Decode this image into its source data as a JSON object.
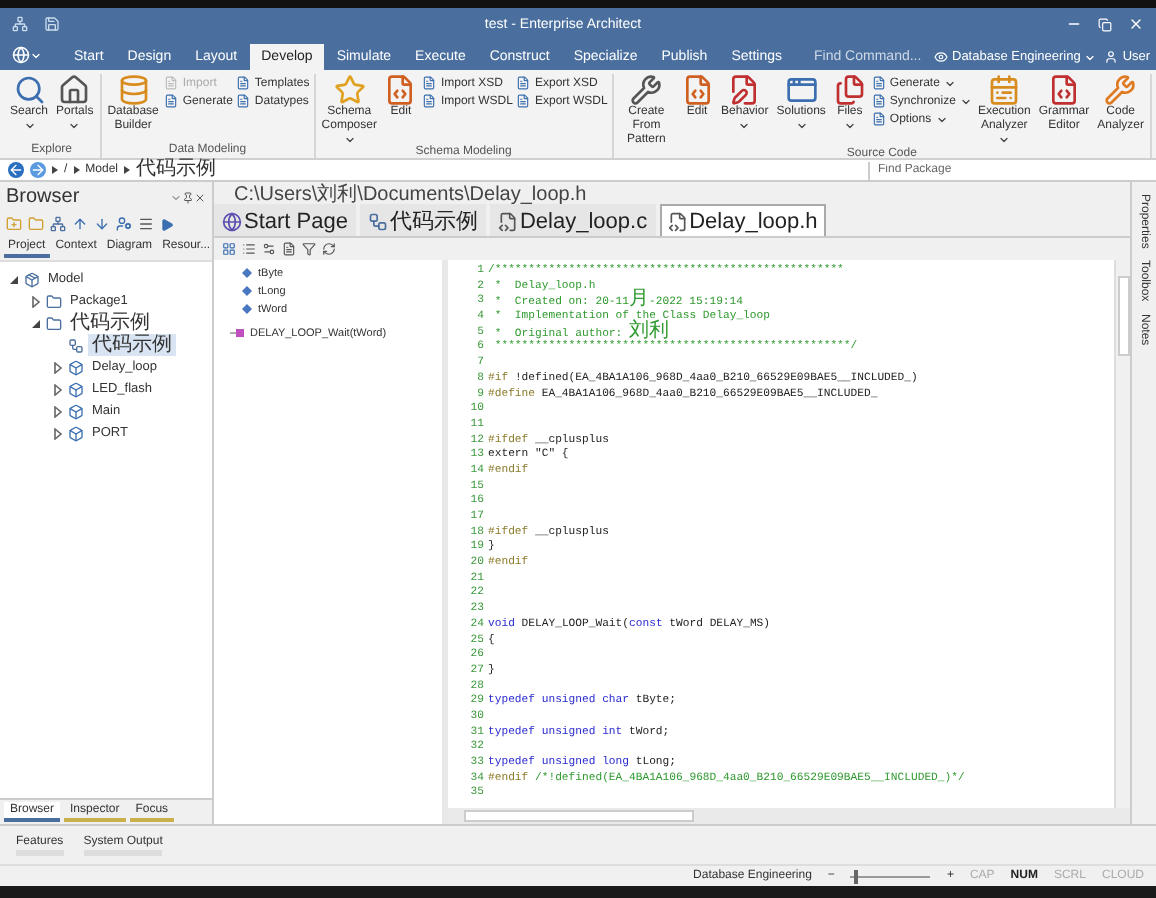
{
  "window": {
    "title": "test - Enterprise Architect"
  },
  "ribbon_tabs": [
    {
      "label": "Start",
      "selected": false
    },
    {
      "label": "Design",
      "selected": false
    },
    {
      "label": "Layout",
      "selected": false
    },
    {
      "label": "Develop",
      "selected": true
    },
    {
      "label": "Simulate",
      "selected": false
    },
    {
      "label": "Execute",
      "selected": false
    },
    {
      "label": "Construct",
      "selected": false
    },
    {
      "label": "Specialize",
      "selected": false
    },
    {
      "label": "Publish",
      "selected": false
    },
    {
      "label": "Settings",
      "selected": false
    }
  ],
  "command_search": {
    "placeholder": "Find Command..."
  },
  "perspective": {
    "label": "Database Engineering"
  },
  "user": {
    "label": "User"
  },
  "ribbon_groups": [
    {
      "label": "Explore",
      "items": [
        {
          "kind": "large",
          "label": "Search",
          "dropdown": true
        },
        {
          "kind": "large",
          "label": "Portals",
          "dropdown": true
        }
      ]
    },
    {
      "label": "Data Modeling",
      "items": [
        {
          "kind": "large",
          "label": "Database\nBuilder",
          "dropdown": false
        },
        {
          "kind": "stack",
          "entries": [
            {
              "label": "Import",
              "disabled": true,
              "dropdown": false
            },
            {
              "label": "Generate",
              "disabled": false,
              "dropdown": false
            }
          ]
        },
        {
          "kind": "stack",
          "entries": [
            {
              "label": "Templates",
              "disabled": false,
              "dropdown": false
            },
            {
              "label": "Datatypes",
              "disabled": false,
              "dropdown": false
            }
          ]
        }
      ]
    },
    {
      "label": "Schema Modeling",
      "items": [
        {
          "kind": "large",
          "label": "Schema\nComposer",
          "dropdown": true
        },
        {
          "kind": "large",
          "label": "Edit",
          "dropdown": false
        },
        {
          "kind": "stack",
          "entries": [
            {
              "label": "Import XSD",
              "disabled": false,
              "dropdown": false
            },
            {
              "label": "Import WSDL",
              "disabled": false,
              "dropdown": false
            }
          ]
        },
        {
          "kind": "stack",
          "entries": [
            {
              "label": "Export XSD",
              "disabled": false,
              "dropdown": false
            },
            {
              "label": "Export WSDL",
              "disabled": false,
              "dropdown": false
            }
          ]
        }
      ]
    },
    {
      "label": "Source Code",
      "items": [
        {
          "kind": "large",
          "label": "Create From\nPattern",
          "dropdown": false
        },
        {
          "kind": "large",
          "label": "Edit",
          "dropdown": false
        },
        {
          "kind": "large",
          "label": "Behavior",
          "dropdown": true
        },
        {
          "kind": "large",
          "label": "Solutions",
          "dropdown": true
        },
        {
          "kind": "large",
          "label": "Files",
          "dropdown": true
        },
        {
          "kind": "stack",
          "entries": [
            {
              "label": "Generate",
              "disabled": false,
              "dropdown": true
            },
            {
              "label": "Synchronize",
              "disabled": false,
              "dropdown": true
            },
            {
              "label": "Options",
              "disabled": false,
              "dropdown": true
            }
          ]
        },
        {
          "kind": "large",
          "label": "Execution\nAnalyzer",
          "dropdown": true
        },
        {
          "kind": "large",
          "label": "Grammar\nEditor",
          "dropdown": false
        },
        {
          "kind": "large",
          "label": "Code\nAnalyzer",
          "dropdown": false
        }
      ]
    }
  ],
  "breadcrumb": {
    "items": [
      "/",
      "Model",
      "代码示例"
    ],
    "find_package": {
      "placeholder": "Find Package"
    }
  },
  "browser": {
    "title": "Browser",
    "tabs": [
      {
        "label": "Project",
        "selected": true
      },
      {
        "label": "Context",
        "selected": false
      },
      {
        "label": "Diagram",
        "selected": false
      },
      {
        "label": "Resour...",
        "selected": false
      }
    ],
    "tree": [
      {
        "kind": "model",
        "label": "Model",
        "expanded": true,
        "selected": false,
        "children": [
          {
            "kind": "package",
            "label": "Package1",
            "expanded": false,
            "selected": false
          },
          {
            "kind": "package",
            "label": "代码示例",
            "expanded": true,
            "selected": false,
            "children": [
              {
                "kind": "diagram",
                "label": "代码示例",
                "selected": true
              },
              {
                "kind": "class",
                "label": "Delay_loop",
                "expanded": false,
                "selected": false
              },
              {
                "kind": "class",
                "label": "LED_flash",
                "expanded": false,
                "selected": false
              },
              {
                "kind": "class",
                "label": "Main",
                "expanded": false,
                "selected": false
              },
              {
                "kind": "class",
                "label": "PORT",
                "expanded": false,
                "selected": false
              }
            ]
          }
        ]
      }
    ],
    "bottom_tabs": [
      {
        "label": "Browser",
        "selected": true
      },
      {
        "label": "Inspector",
        "selected": false
      },
      {
        "label": "Focus",
        "selected": false
      }
    ]
  },
  "editor": {
    "path": "C:\\Users\\刘利\\Documents\\Delay_loop.h",
    "tabs": [
      {
        "kind": "start",
        "label": "Start Page",
        "selected": false
      },
      {
        "kind": "diagram",
        "label": "代码示例",
        "selected": false
      },
      {
        "kind": "file",
        "label": "Delay_loop.c",
        "selected": false
      },
      {
        "kind": "file",
        "label": "Delay_loop.h",
        "selected": true
      }
    ],
    "elements": [
      {
        "kind": "attribute",
        "label": "tByte"
      },
      {
        "kind": "attribute",
        "label": "tLong"
      },
      {
        "kind": "attribute",
        "label": "tWord"
      },
      {
        "kind": "operation",
        "label": "DELAY_LOOP_Wait(tWord)"
      }
    ],
    "code": [
      {
        "number": "1",
        "segments": [
          {
            "kind": "comment",
            "text": "/****************************************************"
          }
        ]
      },
      {
        "number": "2",
        "segments": [
          {
            "kind": "comment",
            "text": " *  Delay_loop.h"
          }
        ]
      },
      {
        "number": "3",
        "segments": [
          {
            "kind": "comment",
            "text": " *  Created on: 20-11"
          },
          {
            "kind": "comment_cjk",
            "text": "月"
          },
          {
            "kind": "comment",
            "text": "-2022 15:19:14"
          }
        ]
      },
      {
        "number": "4",
        "segments": [
          {
            "kind": "comment",
            "text": " *  Implementation of the Class Delay_loop"
          }
        ]
      },
      {
        "number": "5",
        "segments": [
          {
            "kind": "comment",
            "text": " *  Original author: "
          },
          {
            "kind": "comment_cjk",
            "text": "刘利"
          }
        ]
      },
      {
        "number": "6",
        "segments": [
          {
            "kind": "comment",
            "text": " *****************************************************/"
          }
        ]
      },
      {
        "number": "7"
      },
      {
        "number": "8",
        "segments": [
          {
            "kind": "preprocessor",
            "text": "#if "
          },
          {
            "kind": "plain",
            "text": "!defined(EA_4BA1A106_968D_4aa0_B210_66529E09BAE5__INCLUDED_)"
          }
        ]
      },
      {
        "number": "9",
        "segments": [
          {
            "kind": "preprocessor",
            "text": "#define "
          },
          {
            "kind": "plain",
            "text": "EA_4BA1A106_968D_4aa0_B210_66529E09BAE5__INCLUDED_"
          }
        ]
      },
      {
        "number": "10"
      },
      {
        "number": "11"
      },
      {
        "number": "12",
        "segments": [
          {
            "kind": "preprocessor",
            "text": "#ifdef "
          },
          {
            "kind": "plain",
            "text": "__cplusplus"
          }
        ]
      },
      {
        "number": "13",
        "segments": [
          {
            "kind": "plain",
            "text": "extern \"C\" {"
          }
        ]
      },
      {
        "number": "14",
        "segments": [
          {
            "kind": "preprocessor",
            "text": "#endif"
          }
        ]
      },
      {
        "number": "15"
      },
      {
        "number": "16"
      },
      {
        "number": "17"
      },
      {
        "number": "18",
        "segments": [
          {
            "kind": "preprocessor",
            "text": "#ifdef "
          },
          {
            "kind": "plain",
            "text": "__cplusplus"
          }
        ]
      },
      {
        "number": "19",
        "segments": [
          {
            "kind": "plain",
            "text": "}"
          }
        ]
      },
      {
        "number": "20",
        "segments": [
          {
            "kind": "preprocessor",
            "text": "#endif"
          }
        ]
      },
      {
        "number": "21"
      },
      {
        "number": "22"
      },
      {
        "number": "23"
      },
      {
        "number": "24",
        "segments": [
          {
            "kind": "keyword",
            "text": "void "
          },
          {
            "kind": "plain",
            "text": "DELAY_LOOP_Wait("
          },
          {
            "kind": "keyword",
            "text": "const "
          },
          {
            "kind": "plain",
            "text": "tWord DELAY_MS)"
          }
        ]
      },
      {
        "number": "25",
        "segments": [
          {
            "kind": "plain",
            "text": "{"
          }
        ]
      },
      {
        "number": "26"
      },
      {
        "number": "27",
        "segments": [
          {
            "kind": "plain",
            "text": "}"
          }
        ]
      },
      {
        "number": "28"
      },
      {
        "number": "29",
        "segments": [
          {
            "kind": "keyword",
            "text": "typedef unsigned char "
          },
          {
            "kind": "plain",
            "text": "tByte;"
          }
        ]
      },
      {
        "number": "30"
      },
      {
        "number": "31",
        "segments": [
          {
            "kind": "keyword",
            "text": "typedef unsigned int "
          },
          {
            "kind": "plain",
            "text": "tWord;"
          }
        ]
      },
      {
        "number": "32"
      },
      {
        "number": "33",
        "segments": [
          {
            "kind": "keyword",
            "text": "typedef unsigned long "
          },
          {
            "kind": "plain",
            "text": "tLong;"
          }
        ]
      },
      {
        "number": "34",
        "segments": [
          {
            "kind": "preprocessor",
            "text": "#endif "
          },
          {
            "kind": "comment",
            "text": "/*!defined(EA_4BA1A106_968D_4aa0_B210_66529E09BAE5__INCLUDED_)*/"
          }
        ]
      },
      {
        "number": "35"
      }
    ]
  },
  "side_panels": [
    "Properties",
    "Toolbox",
    "Notes"
  ],
  "output_tabs": [
    "Features",
    "System Output"
  ],
  "status_bar": {
    "perspective": "Database Engineering",
    "zoom_minus": "−",
    "zoom_plus": "+",
    "zoom": {
      "level": 0.05
    },
    "indicators": [
      {
        "label": "CAP",
        "on": false
      },
      {
        "label": "NUM",
        "on": true
      },
      {
        "label": "SCRL",
        "on": false
      },
      {
        "label": "CLOUD",
        "on": false
      }
    ]
  }
}
